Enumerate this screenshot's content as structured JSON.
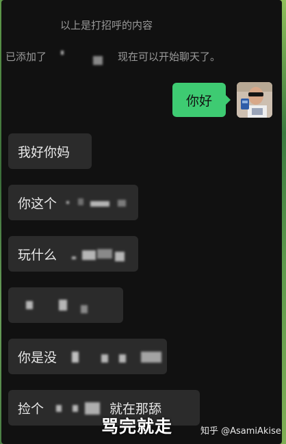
{
  "system_messages": {
    "greeting_hint": "以上是打招呼的内容",
    "added_prefix": "已添加了",
    "added_suffix": "现在可以开始聊天了。"
  },
  "outgoing": [
    {
      "text": "你好"
    }
  ],
  "incoming": [
    {
      "text": "我好你妈"
    },
    {
      "text": "你这个"
    },
    {
      "text": "玩什么"
    },
    {
      "text": ""
    },
    {
      "text": "你是没"
    },
    {
      "text": "捡个",
      "tail": "就在那舔"
    }
  ],
  "overlay": {
    "caption": "骂完就走",
    "watermark": "知乎 @AsamiAkise"
  },
  "colors": {
    "outgoing_bubble": "#3ecb72",
    "incoming_bubble": "#2b2b2b",
    "chat_background": "#111111"
  }
}
